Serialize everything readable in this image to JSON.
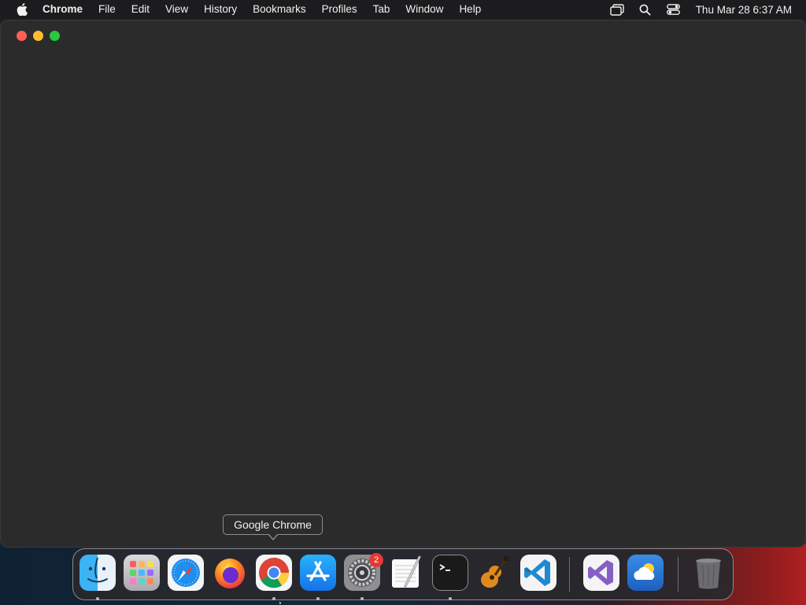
{
  "menubar": {
    "app_name": "Chrome",
    "items": [
      "File",
      "Edit",
      "View",
      "History",
      "Bookmarks",
      "Profiles",
      "Tab",
      "Window",
      "Help"
    ],
    "clock": "Thu Mar 28  6:37 AM",
    "status_icons": [
      "screen-mirroring-icon",
      "spotlight-search-icon",
      "control-center-icon"
    ]
  },
  "window": {
    "traffic_lights": {
      "close": "#fe5f57",
      "minimize": "#febc2e",
      "zoom": "#28c840"
    },
    "background": "#2b2b2b"
  },
  "tooltip": {
    "text": "Google Chrome"
  },
  "dock": {
    "items": [
      {
        "name": "Finder",
        "icon": "finder-icon",
        "running": true
      },
      {
        "name": "Launchpad",
        "icon": "launchpad-icon",
        "running": false
      },
      {
        "name": "Safari",
        "icon": "safari-icon",
        "running": false
      },
      {
        "name": "Firefox",
        "icon": "firefox-icon",
        "running": false
      },
      {
        "name": "Google Chrome",
        "icon": "chrome-icon",
        "running": true
      },
      {
        "name": "App Store",
        "icon": "app-store-icon",
        "running": true
      },
      {
        "name": "System Settings",
        "icon": "system-settings-icon",
        "running": true,
        "badge": "2"
      },
      {
        "name": "TextEdit",
        "icon": "textedit-icon",
        "running": false
      },
      {
        "name": "Terminal",
        "icon": "terminal-icon",
        "running": true
      },
      {
        "name": "GarageBand",
        "icon": "garageband-icon",
        "running": false
      },
      {
        "name": "Visual Studio Code",
        "icon": "vscode-icon",
        "running": false
      },
      {
        "name": "Visual Studio",
        "icon": "visual-studio-icon",
        "running": false
      },
      {
        "name": "Weather",
        "icon": "weather-icon",
        "running": false
      },
      {
        "name": "Trash",
        "icon": "trash-icon",
        "running": false
      }
    ]
  }
}
